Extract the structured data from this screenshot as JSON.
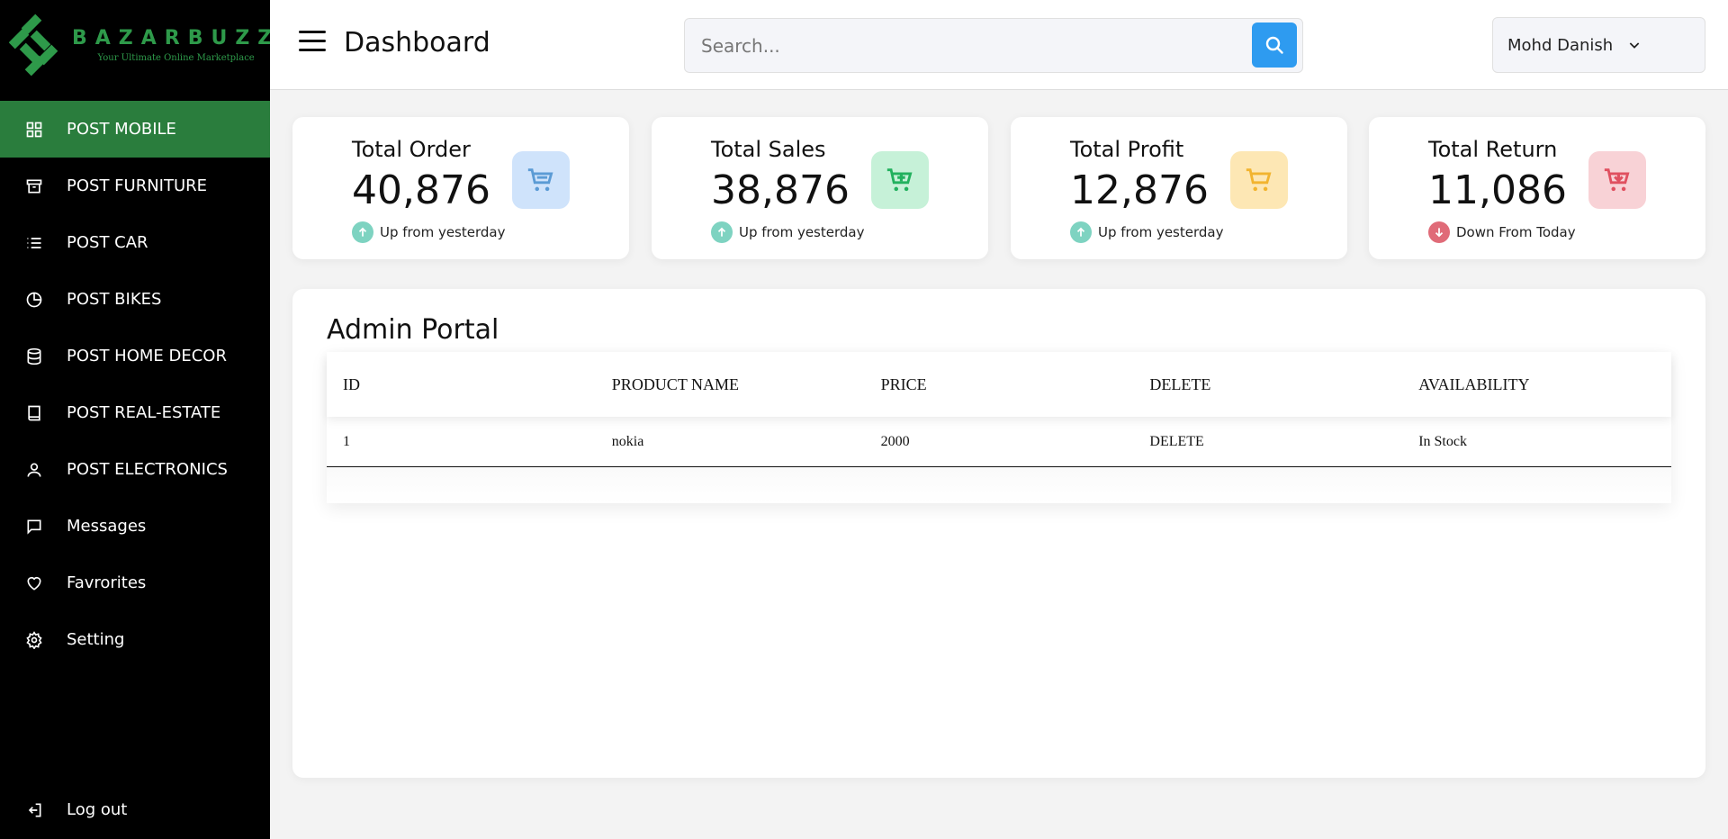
{
  "brand": {
    "name": "BAZARBUZZ",
    "tagline": "Your Ultimate Online Marketplace"
  },
  "sidebar": {
    "items": [
      {
        "label": "POST MOBILE",
        "icon": "grid-icon",
        "active": true
      },
      {
        "label": "POST FURNITURE",
        "icon": "archive-icon"
      },
      {
        "label": "POST CAR",
        "icon": "list-icon"
      },
      {
        "label": "POST BIKES",
        "icon": "pie-chart-icon"
      },
      {
        "label": "POST HOME DECOR",
        "icon": "database-icon"
      },
      {
        "label": "POST REAL-ESTATE",
        "icon": "book-icon"
      },
      {
        "label": "POST ELECTRONICS",
        "icon": "user-icon"
      },
      {
        "label": "Messages",
        "icon": "message-icon"
      },
      {
        "label": "Favrorites",
        "icon": "heart-icon"
      },
      {
        "label": "Setting",
        "icon": "gear-icon"
      }
    ],
    "logout": "Log out"
  },
  "header": {
    "title": "Dashboard",
    "search_placeholder": "Search...",
    "user_name": "Mohd Danish"
  },
  "cards": [
    {
      "title": "Total Order",
      "value": "40,876",
      "trend": "Up from yesterday",
      "direction": "up",
      "icon_color": "#5b9bd5",
      "icon_bg": "#cfe3fb"
    },
    {
      "title": "Total Sales",
      "value": "38,876",
      "trend": "Up from yesterday",
      "direction": "up",
      "icon_color": "#22b15e",
      "icon_bg": "#c6f1d8"
    },
    {
      "title": "Total Profit",
      "value": "12,876",
      "trend": "Up from yesterday",
      "direction": "up",
      "icon_color": "#f2b42f",
      "icon_bg": "#fde7b4"
    },
    {
      "title": "Total Return",
      "value": "11,086",
      "trend": "Down From Today",
      "direction": "down",
      "icon_color": "#e05060",
      "icon_bg": "#f8d2d6"
    }
  ],
  "portal": {
    "title": "Admin Portal",
    "columns": [
      "ID",
      "PRODUCT NAME",
      "PRICE",
      "DELETE",
      "AVAILABILITY"
    ],
    "rows": [
      [
        "1",
        "nokia",
        "2000",
        "DELETE",
        "In Stock"
      ]
    ]
  },
  "colors": {
    "active_nav": "#2a7d3d",
    "brand": "#2e9a4a",
    "search_button": "#2e9bf0",
    "trend_up": "#7ed3c1",
    "trend_down": "#e06b78"
  }
}
